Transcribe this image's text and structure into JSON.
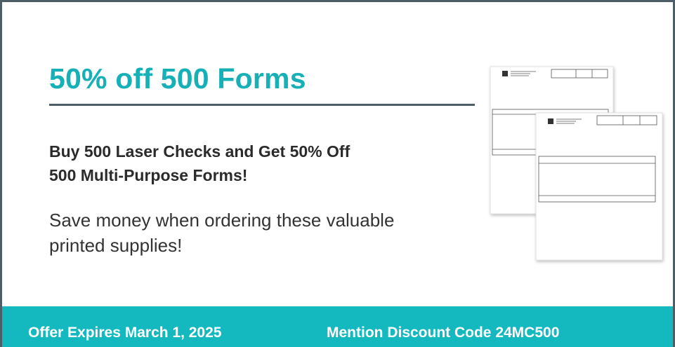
{
  "promo": {
    "title": "50% off 500 Forms",
    "subhead_line1": "Buy 500 Laser Checks and Get 50% Off",
    "subhead_line2": "500 Multi-Purpose Forms!",
    "body_line1": "Save money when ordering these valuable",
    "body_line2": "printed supplies!"
  },
  "footer": {
    "expires": "Offer Expires March 1, 2025",
    "discount_code": "Mention Discount Code 24MC500"
  },
  "colors": {
    "accent": "#17b0b7",
    "footer_bg": "#14b8bf",
    "border": "#4d5e67"
  },
  "illustration": {
    "icon": "multi-purpose-forms-image"
  }
}
